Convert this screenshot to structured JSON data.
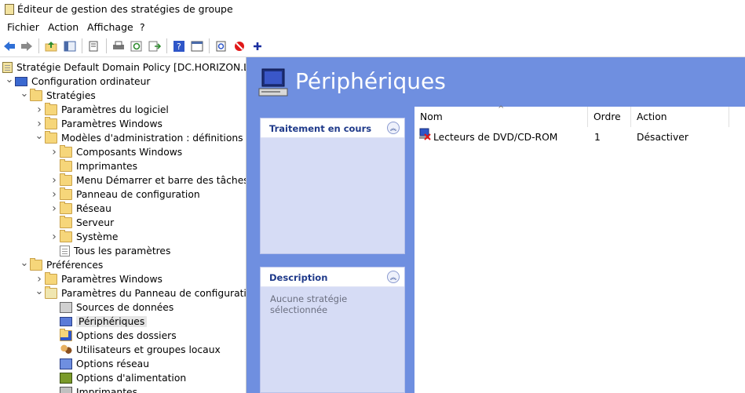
{
  "window": {
    "title": "Éditeur de gestion des stratégies de groupe"
  },
  "menu": [
    "Fichier",
    "Action",
    "Affichage",
    "?"
  ],
  "toolbar": {
    "icons": [
      "back-icon",
      "forward-icon",
      "up-folder-icon",
      "show-tree-icon",
      "copy-icon",
      "print-icon",
      "refresh-icon",
      "export-icon",
      "help-icon",
      "properties-icon",
      "new-item-icon",
      "stop-icon",
      "add-icon"
    ]
  },
  "tree": [
    {
      "label": "Stratégie Default Domain Policy [DC.HORIZON.LOCAL]",
      "depth": 0,
      "expander": "",
      "icon": "policy"
    },
    {
      "label": "Configuration ordinateur",
      "depth": 0,
      "expander": "open",
      "icon": "computer"
    },
    {
      "label": "Stratégies",
      "depth": 1,
      "expander": "open",
      "icon": "folder"
    },
    {
      "label": "Paramètres du logiciel",
      "depth": 2,
      "expander": "closed",
      "icon": "folder"
    },
    {
      "label": "Paramètres Windows",
      "depth": 2,
      "expander": "closed",
      "icon": "folder"
    },
    {
      "label": "Modèles d'administration : définitions de stratégies",
      "depth": 2,
      "expander": "open",
      "icon": "folder"
    },
    {
      "label": "Composants Windows",
      "depth": 3,
      "expander": "closed",
      "icon": "folder"
    },
    {
      "label": "Imprimantes",
      "depth": 3,
      "expander": "",
      "icon": "folder"
    },
    {
      "label": "Menu Démarrer et barre des tâches",
      "depth": 3,
      "expander": "closed",
      "icon": "folder"
    },
    {
      "label": "Panneau de configuration",
      "depth": 3,
      "expander": "closed",
      "icon": "folder"
    },
    {
      "label": "Réseau",
      "depth": 3,
      "expander": "closed",
      "icon": "folder"
    },
    {
      "label": "Serveur",
      "depth": 3,
      "expander": "",
      "icon": "folder"
    },
    {
      "label": "Système",
      "depth": 3,
      "expander": "closed",
      "icon": "folder"
    },
    {
      "label": "Tous les paramètres",
      "depth": 3,
      "expander": "",
      "icon": "doc"
    },
    {
      "label": "Préférences",
      "depth": 1,
      "expander": "open",
      "icon": "folder"
    },
    {
      "label": "Paramètres Windows",
      "depth": 2,
      "expander": "closed",
      "icon": "folder"
    },
    {
      "label": "Paramètres du Panneau de configuration",
      "depth": 2,
      "expander": "open",
      "icon": "cpanel"
    },
    {
      "label": "Sources de données",
      "depth": 3,
      "expander": "",
      "icon": "datasrc"
    },
    {
      "label": "Périphériques",
      "depth": 3,
      "expander": "",
      "icon": "pc",
      "selected": true
    },
    {
      "label": "Options des dossiers",
      "depth": 3,
      "expander": "",
      "icon": "folderopt"
    },
    {
      "label": "Utilisateurs et groupes locaux",
      "depth": 3,
      "expander": "",
      "icon": "users"
    },
    {
      "label": "Options réseau",
      "depth": 3,
      "expander": "",
      "icon": "network"
    },
    {
      "label": "Options d'alimentation",
      "depth": 3,
      "expander": "",
      "icon": "power"
    },
    {
      "label": "Imprimantes",
      "depth": 3,
      "expander": "",
      "icon": "printer"
    }
  ],
  "details": {
    "title": "Périphériques",
    "processing_panel": {
      "title": "Traitement en cours"
    },
    "description_panel": {
      "title": "Description",
      "text": "Aucune stratégie sélectionnée"
    },
    "columns": [
      "Nom",
      "Ordre",
      "Action"
    ],
    "rows": [
      {
        "name": "Lecteurs de DVD/CD-ROM",
        "order": "1",
        "action": "Désactiver"
      }
    ]
  }
}
